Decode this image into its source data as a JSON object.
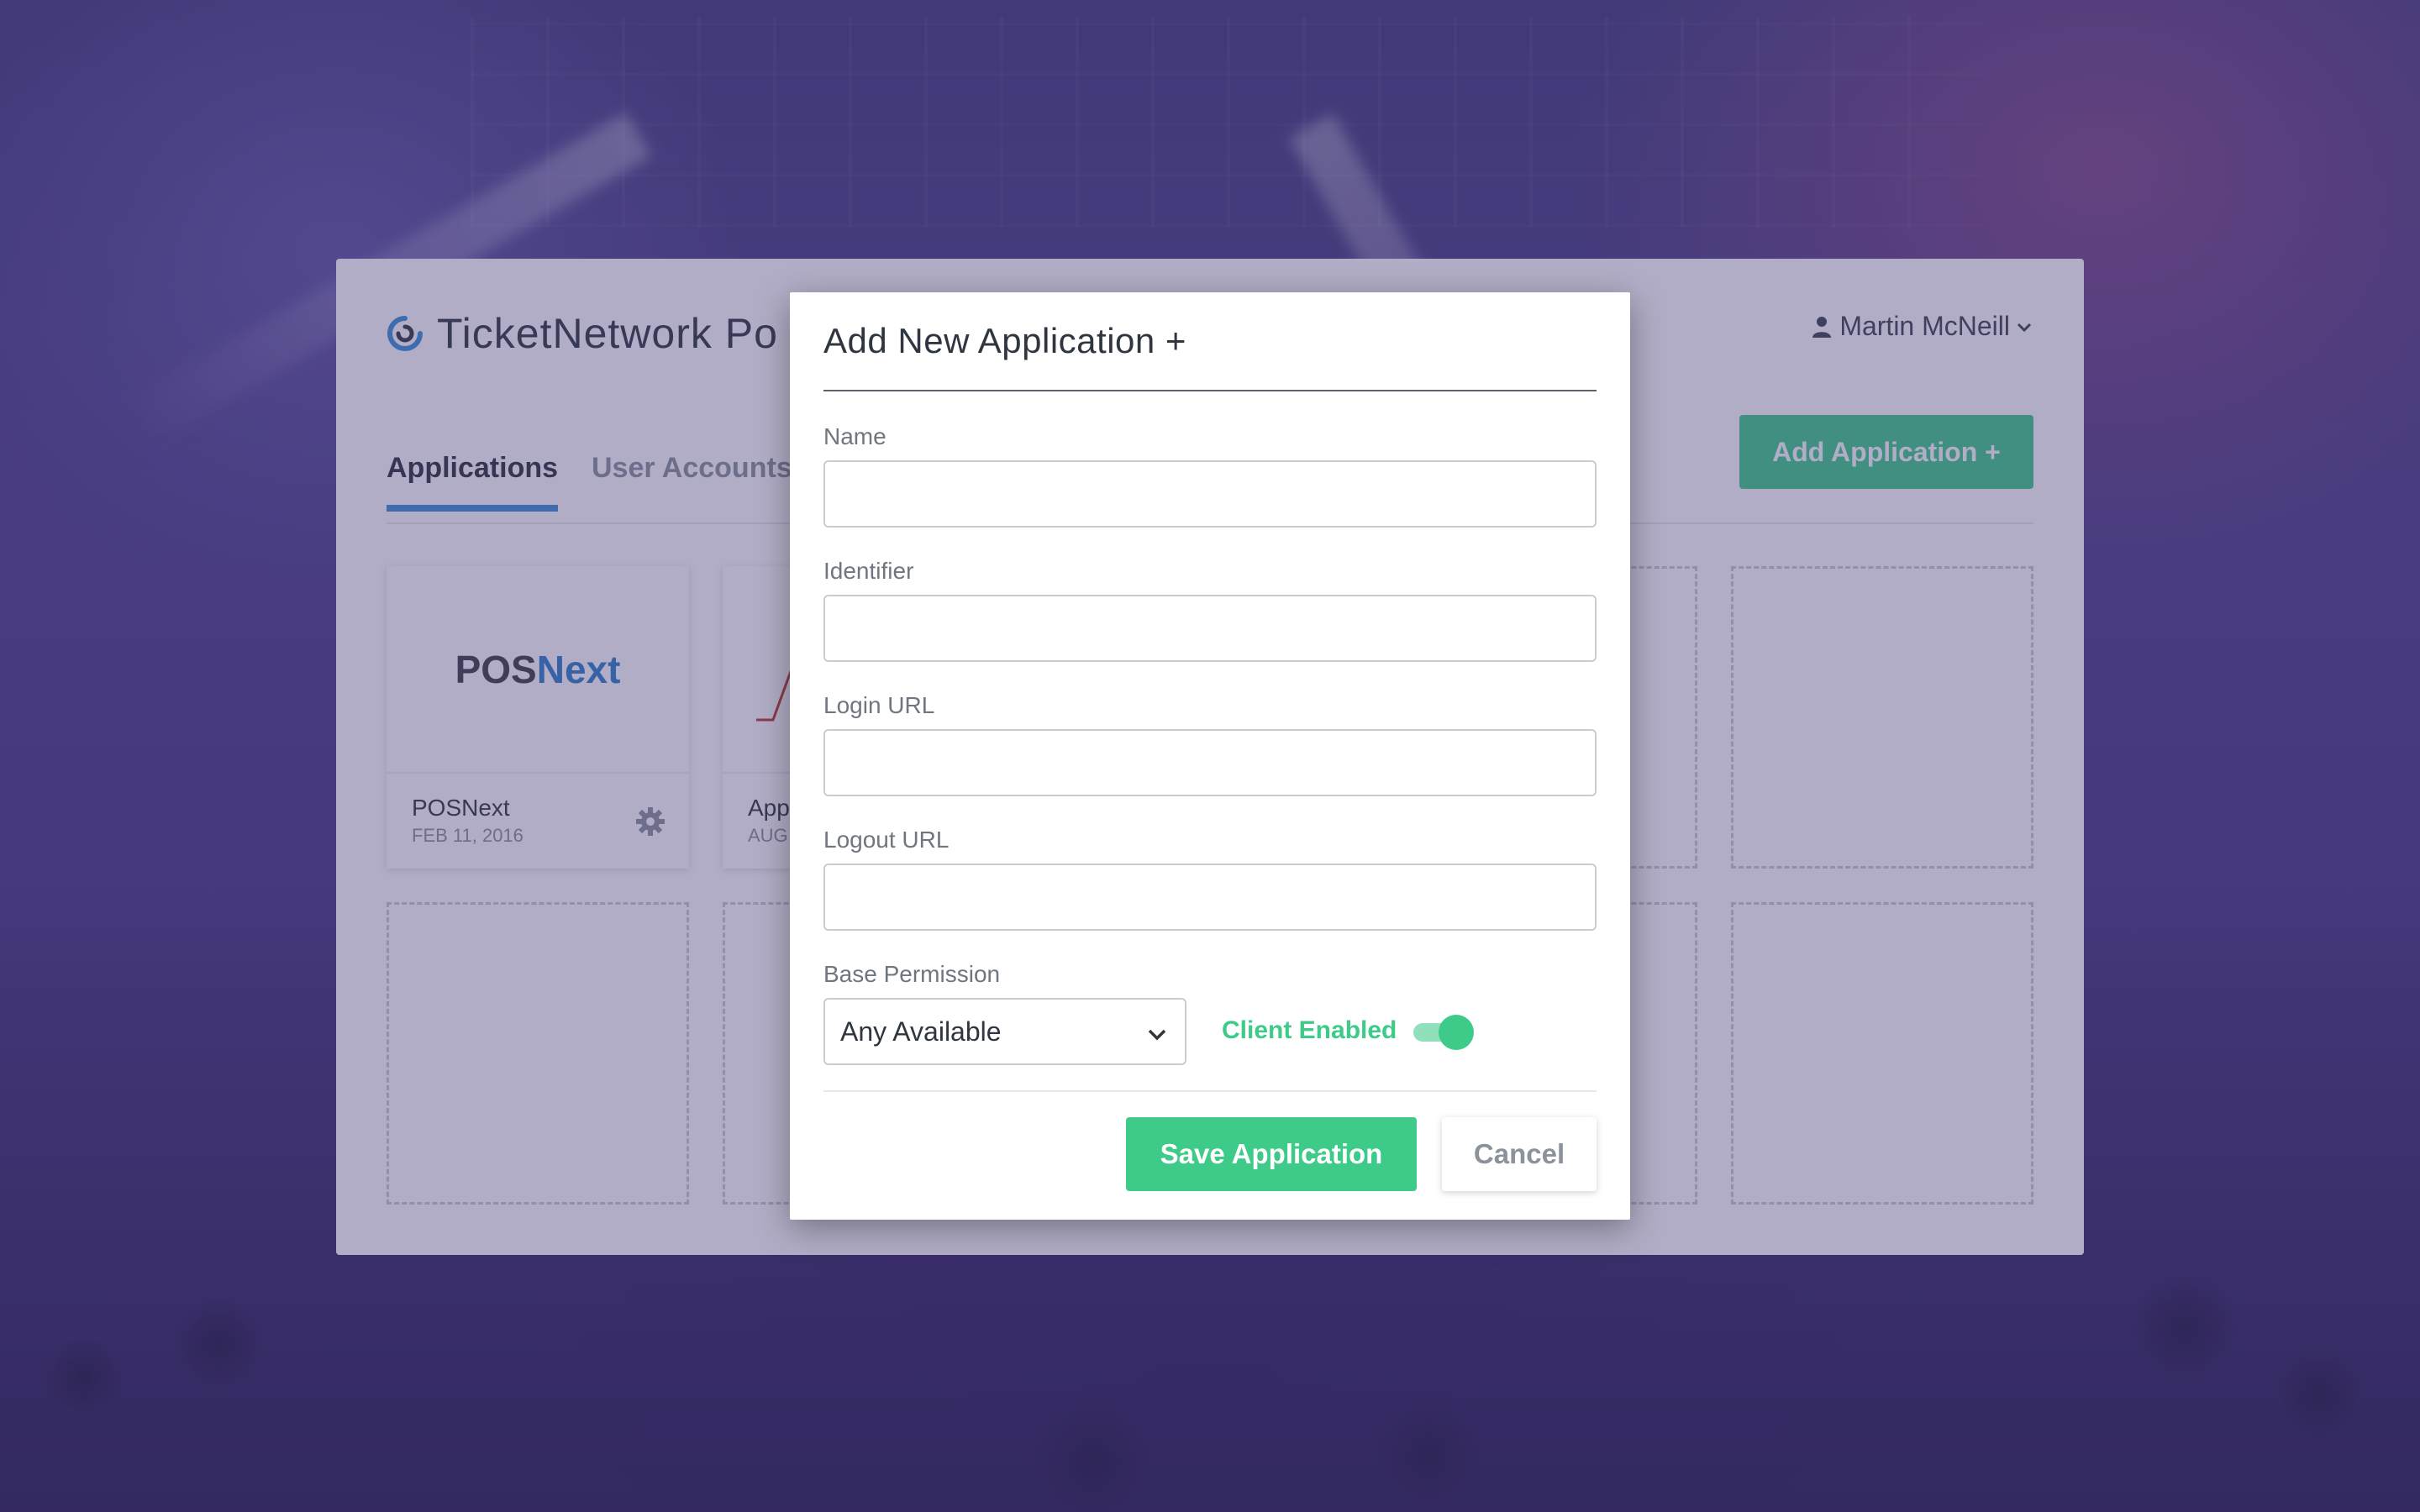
{
  "background": {
    "app": {
      "brand_title": "TicketNetwork Po",
      "user_name": "Martin McNeill",
      "tabs": [
        {
          "label": "Applications",
          "active": true
        },
        {
          "label": "User Accounts",
          "active": false
        }
      ],
      "add_button_label": "Add Application +",
      "cards": [
        {
          "name": "POSNext",
          "date": "FEB 11, 2016",
          "logo_left": "POS",
          "logo_right": "Next"
        },
        {
          "name": "App",
          "date": "AUG"
        }
      ]
    }
  },
  "modal": {
    "title": "Add New Application +",
    "fields": {
      "name": {
        "label": "Name",
        "value": "",
        "placeholder": ""
      },
      "identifier": {
        "label": "Identifier",
        "value": "",
        "placeholder": ""
      },
      "login_url": {
        "label": "Login URL",
        "value": "",
        "placeholder": ""
      },
      "logout_url": {
        "label": "Logout URL",
        "value": "",
        "placeholder": ""
      }
    },
    "base_permission": {
      "label": "Base Permission",
      "selected": "Any Available"
    },
    "client_enabled": {
      "label": "Client Enabled",
      "on": true
    },
    "buttons": {
      "save": "Save Application",
      "cancel": "Cancel"
    }
  },
  "colors": {
    "accent_green": "#3ecb89",
    "accent_blue": "#3b8fd6",
    "text_dark": "#2f3640",
    "text_muted": "#6f7680"
  }
}
